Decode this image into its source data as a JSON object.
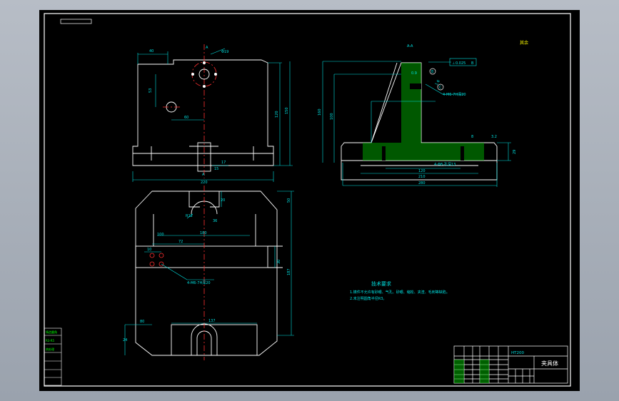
{
  "drawing": {
    "tech_title": "技术要求",
    "tech_line1": "1.铸件不允许有砂眼、气孔、砂眼、缩松、夹渣、毛刺等缺陷。",
    "tech_line2": "2.未注明圆角半径R3。",
    "section_label": "A-A",
    "roughness_note": "其余",
    "material": "HT200",
    "part_name": "夹具体",
    "tol_frame_sym": "⊥",
    "tol_frame_val": "0.025",
    "tol_frame_ref": "B",
    "datum_b": "B",
    "datum_c": "C",
    "dims": {
      "d40": "40",
      "dia19": "Φ19",
      "d53": "53",
      "d60": "60",
      "d120": "120",
      "d150": "150",
      "d17": "17",
      "d15": "15",
      "d220": "220",
      "dA_top": "A",
      "dA_bot": "A",
      "d20": "20",
      "r12": "R12",
      "d180": "180",
      "d100": "100",
      "d10": "10",
      "d72": "72",
      "d187": "187",
      "d50": "50",
      "hole4": "4-M6-7H深20",
      "d80": "80",
      "d137": "137",
      "d24": "24",
      "d36": "36",
      "d30": "30",
      "s160": "160",
      "s100": "100",
      "hole_side1": "4-M6-7H深20",
      "hole_side2": "4-Φ8-孔深13",
      "s120": "120",
      "s210": "210",
      "s280": "280",
      "s29": "29",
      "s8": "8",
      "s09": "0.9",
      "s32": "3.2",
      "s16": "1.6"
    },
    "left_block": [
      "铸造圆角",
      "R3-R5",
      "热处理",
      "",
      "",
      ""
    ]
  }
}
